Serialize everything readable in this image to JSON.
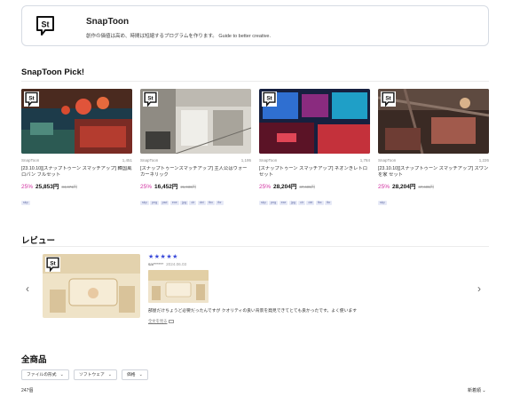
{
  "shop": {
    "name": "SnapToon",
    "description": "創作の価値は高め、時間は短縮するプログラムを作ります。 Guide to better creative."
  },
  "pick": {
    "title": "SnapToon Pick!",
    "products": [
      {
        "store": "SnapToon",
        "likes": "1,451",
        "title": "[23.10.10][スナップトゥーン スマッチアップ] 韓国風ロバン フルセット",
        "discount": "25%",
        "price": "25,853円",
        "old_price": "34,471円",
        "tags": [
          "skp"
        ]
      },
      {
        "store": "SnapToon",
        "likes": "1,195",
        "title": "[スナップトゥーンスマッチアップ] 主人公はウォーカーネリック",
        "discount": "25%",
        "price": "16,452円",
        "old_price": "21,936円",
        "tags": [
          "skp",
          "png",
          "psd",
          "exe",
          "jpg",
          "clr",
          "dxt",
          "fbx",
          "fbr"
        ]
      },
      {
        "store": "SnapToon",
        "likes": "1,784",
        "title": "[スナップトゥーン スマッチアップ] ネオンきレトロセット",
        "discount": "25%",
        "price": "28,204円",
        "old_price": "37,605円",
        "tags": [
          "skp",
          "png",
          "exe",
          "jpg",
          "clr",
          "dxt",
          "fbx",
          "fbr"
        ]
      },
      {
        "store": "SnapToon",
        "likes": "1,226",
        "title": "[23.10.10][スナップトゥーン スマッチアップ] スワンを家 セット",
        "discount": "25%",
        "price": "28,204円",
        "old_price": "37,605円",
        "tags": [
          "skp"
        ]
      }
    ]
  },
  "reviews": {
    "title": "レビュー",
    "stars": "★★★★★",
    "reviewer": "sar******",
    "date": "2024.06.03",
    "text": "部屋だけちょうど必要だったんですが クオリティの良い背景を発見できてとても良かったです。よく使います",
    "more_label": "全文を見る"
  },
  "all": {
    "title": "全商品",
    "filters": [
      "ファイルの形式",
      "ソフトウェア",
      "価格"
    ],
    "count": "247個",
    "sort_label": "新着順"
  },
  "icons": {
    "logo": "snaptoon-logo-icon",
    "prev": "chevron-left-icon",
    "next": "chevron-right-icon",
    "dropdown": "chevron-down-icon"
  },
  "colors": {
    "discount": "#d12fa0",
    "stars": "#3a4ad9",
    "tag_bg": "#e7eaf7"
  }
}
